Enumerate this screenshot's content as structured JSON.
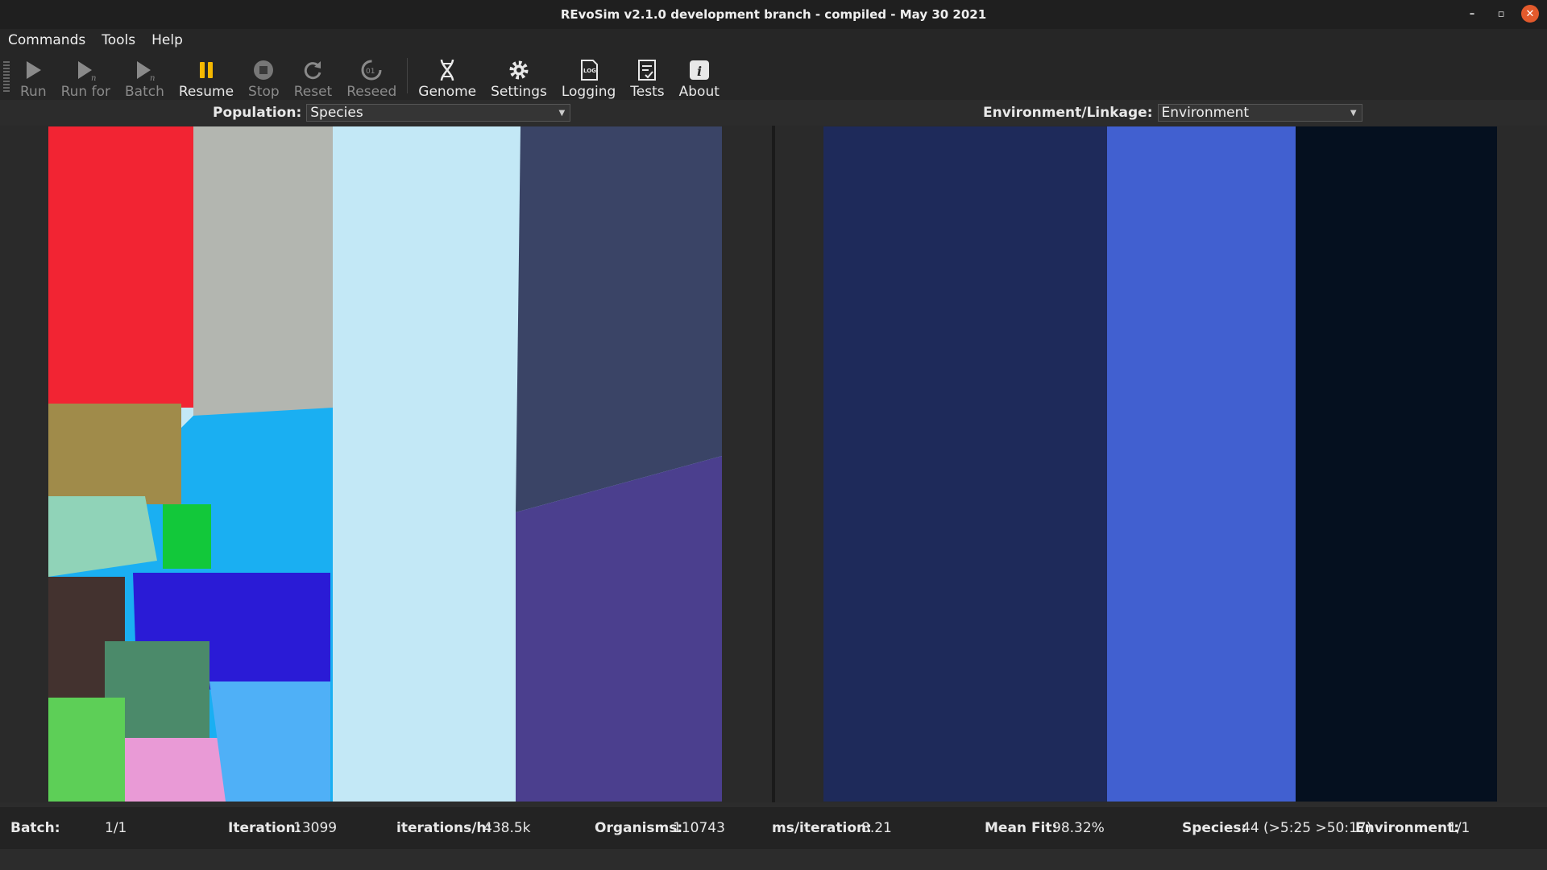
{
  "window": {
    "title": "REvoSim v2.1.0 development branch - compiled - May 30 2021",
    "controls": [
      "–",
      "▫",
      "✕"
    ]
  },
  "menu": [
    "Commands",
    "Tools",
    "Help"
  ],
  "toolbar": {
    "run": "Run",
    "run_for": "Run for",
    "batch": "Batch",
    "resume": "Resume",
    "stop": "Stop",
    "reset": "Reset",
    "reseed": "Reseed",
    "genome": "Genome",
    "settings": "Settings",
    "logging": "Logging",
    "tests": "Tests",
    "about": "About"
  },
  "population": {
    "label": "Population:",
    "selected": "Species",
    "colors": [
      "#f22433",
      "#b3b6b0",
      "#c3e8f6",
      "#3a4466",
      "#4b3f8e",
      "#a08b4a",
      "#1aaff2",
      "#90d3b8",
      "#12c83a",
      "#2a1bd6",
      "#43322f",
      "#4b8a6a",
      "#5dcf57",
      "#e99ad6",
      "#4fb0f7"
    ]
  },
  "environment": {
    "label": "Environment/Linkage:",
    "selected": "Environment",
    "colors": [
      "#1e2a5a",
      "#4160d0",
      "#05101f"
    ]
  },
  "status": {
    "batch_label": "Batch:",
    "batch_value": "1/1",
    "iteration_label": "Iteration:",
    "iteration_value": "13099",
    "rate_label": "iterations/h:",
    "rate_value": "438.5k",
    "organisms_label": "Organisms:",
    "organisms_value": "110743",
    "ms_label": "ms/iteration:",
    "ms_value": "8.21",
    "fit_label": "Mean Fit:",
    "fit_value": "98.32%",
    "species_label": "Species:",
    "species_value": "44 (>5:25 >50:17)",
    "env_label": "Environment:",
    "env_value": "1/1"
  }
}
